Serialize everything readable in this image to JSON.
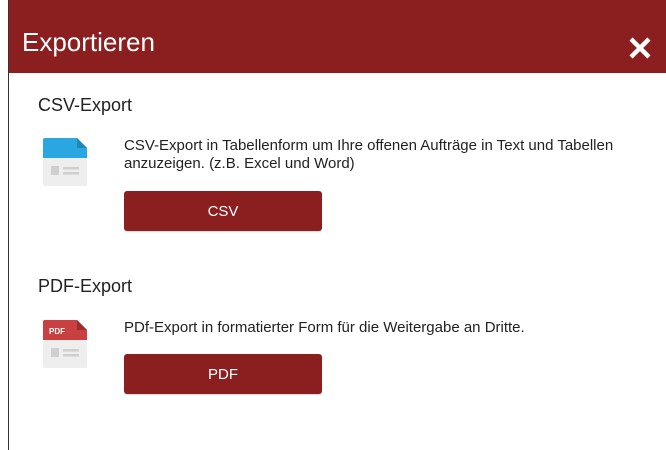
{
  "dialog": {
    "title": "Exportieren",
    "close_icon": "close-icon"
  },
  "colors": {
    "header": "#8b1f1f",
    "button": "#8b1f1f",
    "csv_icon_accent": "#2aa7e0",
    "pdf_icon_accent": "#c94040"
  },
  "csv": {
    "title": "CSV-Export",
    "description": "CSV-Export in Tabellenform um Ihre offenen Aufträge in Text und Tabellen anzuzeigen. (z.B. Excel und Word)",
    "button_label": "CSV",
    "icon": "csv-file-icon"
  },
  "pdf": {
    "title": "PDF-Export",
    "description": "PDf-Export in formatierter Form für die Weitergabe an Dritte.",
    "button_label": "PDF",
    "icon": "pdf-file-icon",
    "icon_text": "PDF"
  }
}
